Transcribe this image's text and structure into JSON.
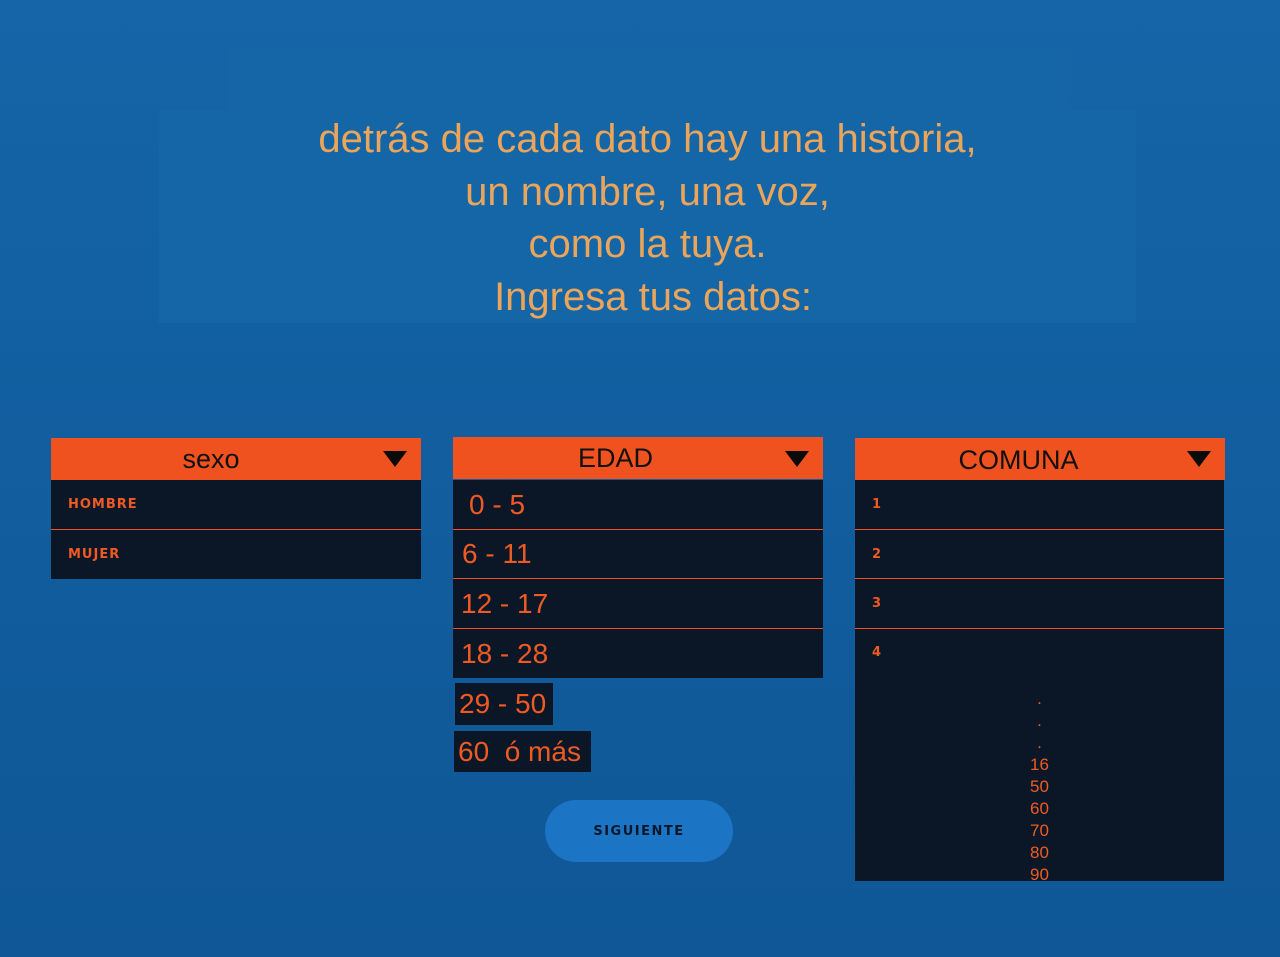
{
  "intro": {
    "lines": [
      "detrás de cada dato hay una historia,",
      "un nombre, una voz,",
      "como la tuya.",
      " Ingresa tus datos:"
    ]
  },
  "sexo": {
    "header": "sexo",
    "options": [
      "HOMBRE",
      "MUJER"
    ]
  },
  "edad": {
    "header": "EDAD",
    "options": [
      "0 - 5",
      "6 - 11",
      "12 - 17",
      "18 - 28"
    ],
    "extra": [
      "29 - 50",
      "60  ó más"
    ]
  },
  "comuna": {
    "header": "COMUNA",
    "options": [
      "1",
      "2",
      "3",
      "4"
    ],
    "ellipsis": [
      ".",
      ".",
      "."
    ],
    "extra": [
      "16",
      "50",
      "60",
      "70",
      "80",
      "90"
    ]
  },
  "next_button": {
    "label": "SIGUIENTE"
  },
  "icons": {
    "dropdown": "caret-down-icon"
  },
  "colors": {
    "background": "#1466a7",
    "accent": "#ef521e",
    "panel": "#0b1727",
    "intro_text": "#eaa55b",
    "button": "#1b74c4"
  }
}
